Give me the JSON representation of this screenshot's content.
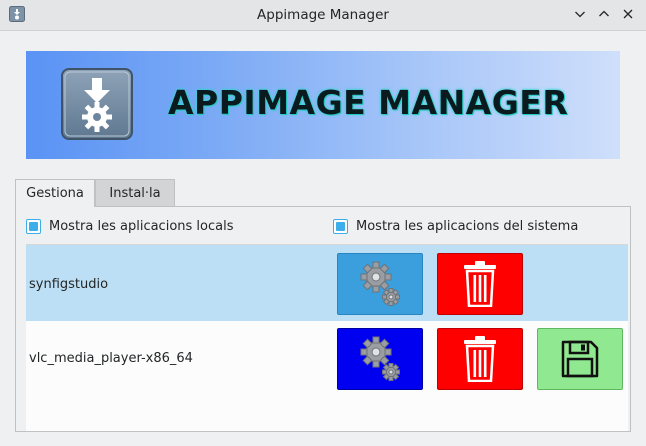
{
  "window": {
    "title": "Appimage Manager",
    "controls": [
      "chevron-down-icon",
      "chevron-up-icon",
      "close-icon"
    ]
  },
  "banner": {
    "title": "APPIMAGE MANAGER",
    "icon": "appimage-install-icon"
  },
  "tabs": [
    {
      "label": "Gestiona",
      "active": true
    },
    {
      "label": "Instal·la",
      "active": false
    }
  ],
  "options": {
    "local": {
      "label": "Mostra les aplicacions locals",
      "checked": true
    },
    "system": {
      "label": "Mostra les aplicacions del sistema",
      "checked": true
    }
  },
  "apps": [
    {
      "name": "synfigstudio",
      "selected": true,
      "actions": [
        "settings",
        "delete"
      ]
    },
    {
      "name": "vlc_media_player-x86_64",
      "selected": false,
      "actions": [
        "settings",
        "delete",
        "save"
      ]
    }
  ],
  "colors": {
    "accent": "#3daee9",
    "settings_selected": "#3a9fdc",
    "settings_normal": "#0000f0",
    "delete": "#ff0000",
    "save": "#90e890",
    "row_selected": "#bcdff5"
  }
}
